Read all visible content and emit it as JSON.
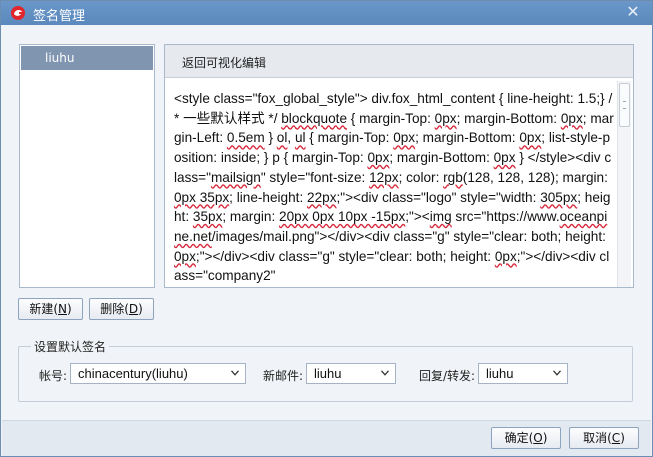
{
  "window": {
    "title": "签名管理",
    "close_glyph": "✕"
  },
  "signature_list": {
    "items": [
      {
        "label": "liuhu",
        "selected": true
      }
    ]
  },
  "editor": {
    "tab_label": "返回可视化编辑",
    "content_segments": [
      {
        "text": "<style class=\"fox_global_style\"> div.fox_html_content { line-height: 1.5;} /* 一些默认样式 */ ",
        "spell": false
      },
      {
        "text": "blockquote",
        "spell": true
      },
      {
        "text": " { margin-Top: ",
        "spell": false
      },
      {
        "text": "0px",
        "spell": true
      },
      {
        "text": "; margin-Bottom: ",
        "spell": false
      },
      {
        "text": "0px",
        "spell": true
      },
      {
        "text": "; margin-Left: ",
        "spell": false
      },
      {
        "text": "0.5em",
        "spell": true
      },
      {
        "text": " } ",
        "spell": false
      },
      {
        "text": "ol",
        "spell": true
      },
      {
        "text": ", ",
        "spell": false
      },
      {
        "text": "ul",
        "spell": true
      },
      {
        "text": " { margin-Top: ",
        "spell": false
      },
      {
        "text": "0px",
        "spell": true
      },
      {
        "text": "; margin-Bottom: ",
        "spell": false
      },
      {
        "text": "0px",
        "spell": true
      },
      {
        "text": "; list-style-position: inside; } p { margin-Top: ",
        "spell": false
      },
      {
        "text": "0px",
        "spell": true
      },
      {
        "text": "; margin-Bottom: ",
        "spell": false
      },
      {
        "text": "0px",
        "spell": true
      },
      {
        "text": " } </style><div class=\"",
        "spell": false
      },
      {
        "text": "mailsign",
        "spell": true
      },
      {
        "text": "\" style=\"font-size: ",
        "spell": false
      },
      {
        "text": "12px",
        "spell": true
      },
      {
        "text": "; color: ",
        "spell": false
      },
      {
        "text": "rgb",
        "spell": true
      },
      {
        "text": "(128, 128, 128); margin: ",
        "spell": false
      },
      {
        "text": "0px 35px",
        "spell": true
      },
      {
        "text": "; line-height: ",
        "spell": false
      },
      {
        "text": "22px",
        "spell": true
      },
      {
        "text": ";\"><div class=\"logo\" style=\"width: ",
        "spell": false
      },
      {
        "text": "305px",
        "spell": true
      },
      {
        "text": "; height: ",
        "spell": false
      },
      {
        "text": "35px",
        "spell": true
      },
      {
        "text": "; margin: ",
        "spell": false
      },
      {
        "text": "20px 0px 10px -15px",
        "spell": true
      },
      {
        "text": ";\"><",
        "spell": false
      },
      {
        "text": "img",
        "spell": true
      },
      {
        "text": " src=\"https://www.",
        "spell": false
      },
      {
        "text": "oceanpine.net",
        "spell": true
      },
      {
        "text": "/images/mail.png\"></div><div class=\"g\" style=\"clear: both; height: ",
        "spell": false
      },
      {
        "text": "0px",
        "spell": true
      },
      {
        "text": ";\"></div><div class=\"g\" style=\"clear: both; height: ",
        "spell": false
      },
      {
        "text": "0px",
        "spell": true
      },
      {
        "text": ";\"></div><div class=\"company2\"",
        "spell": false
      }
    ]
  },
  "actions": {
    "new_label": "新建(",
    "new_key": "N",
    "delete_label": "删除(",
    "delete_key": "D",
    "close_paren": ")"
  },
  "defaults": {
    "legend": "设置默认签名",
    "account_label": "帐号:",
    "account_value": "chinacentury(liuhu)",
    "new_mail_label": "新邮件:",
    "new_mail_value": "liuhu",
    "reply_label": "回复/转发:",
    "reply_value": "liuhu"
  },
  "footer": {
    "ok_label": "确定(",
    "ok_key": "O",
    "cancel_label": "取消(",
    "cancel_key": "C"
  },
  "colors": {
    "titlebar": "#5b89bd",
    "selected_item": "#7f95b0",
    "app_icon_red": "#e2262e"
  }
}
